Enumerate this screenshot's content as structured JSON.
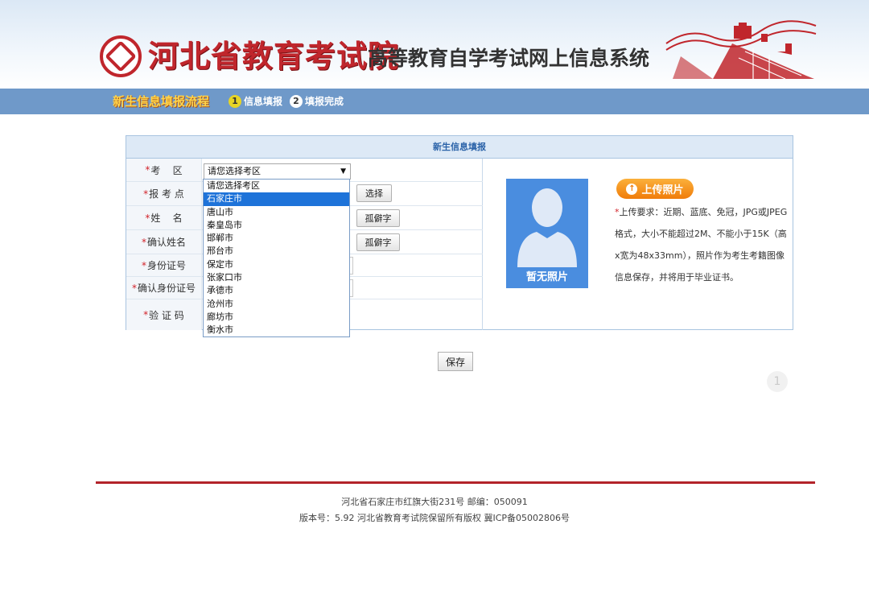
{
  "header": {
    "logo_name": "河北省教育考试院",
    "system_title": "高等教育自学考试网上信息系统"
  },
  "process": {
    "title": "新生信息填报流程",
    "steps": [
      {
        "num": "1",
        "label": "信息填报"
      },
      {
        "num": "2",
        "label": "填报完成"
      }
    ]
  },
  "panel": {
    "title": "新生信息填报",
    "rows": [
      {
        "label": "考    区",
        "required": "*"
      },
      {
        "label": "报 考 点",
        "required": "*"
      },
      {
        "label": "姓    名",
        "required": "*"
      },
      {
        "label": "确认姓名",
        "required": "*"
      },
      {
        "label": "身份证号",
        "required": "*"
      },
      {
        "label": "确认身份证号",
        "required": "*"
      },
      {
        "label": "验 证 码",
        "required": "*"
      }
    ],
    "select": {
      "value": "请您选择考区",
      "arrow": "▼",
      "options": [
        "请您选择考区",
        "石家庄市",
        "唐山市",
        "秦皇岛市",
        "邯郸市",
        "邢台市",
        "保定市",
        "张家口市",
        "承德市",
        "沧州市",
        "廊坊市",
        "衡水市"
      ],
      "highlighted_index": 1
    },
    "buttons": {
      "choose": "选择",
      "rare_char_1": "孤僻字",
      "rare_char_2": "孤僻字"
    }
  },
  "photo": {
    "placeholder_label": "暂无照片",
    "upload_label": "上传照片",
    "requirement": "上传要求：近期、蓝底、免冠，JPG或JPEG格式，大小不能超过2M、不能小于15K（高x宽为48x33mm），照片作为考生考籍图像信息保存，并将用于毕业证书。",
    "requirement_mark": "*"
  },
  "actions": {
    "save": "保存",
    "page": "1"
  },
  "footer": {
    "address": "河北省石家庄市红旗大街231号 邮编：050091",
    "copyright": "版本号：5.92 河北省教育考试院保留所有版权 冀ICP备05002806号"
  },
  "colors": {
    "brand_red": "#c0262c",
    "bar_blue": "#6f99c9",
    "select_highlight": "#1e73d9",
    "upload_orange": "#f07c0a"
  }
}
